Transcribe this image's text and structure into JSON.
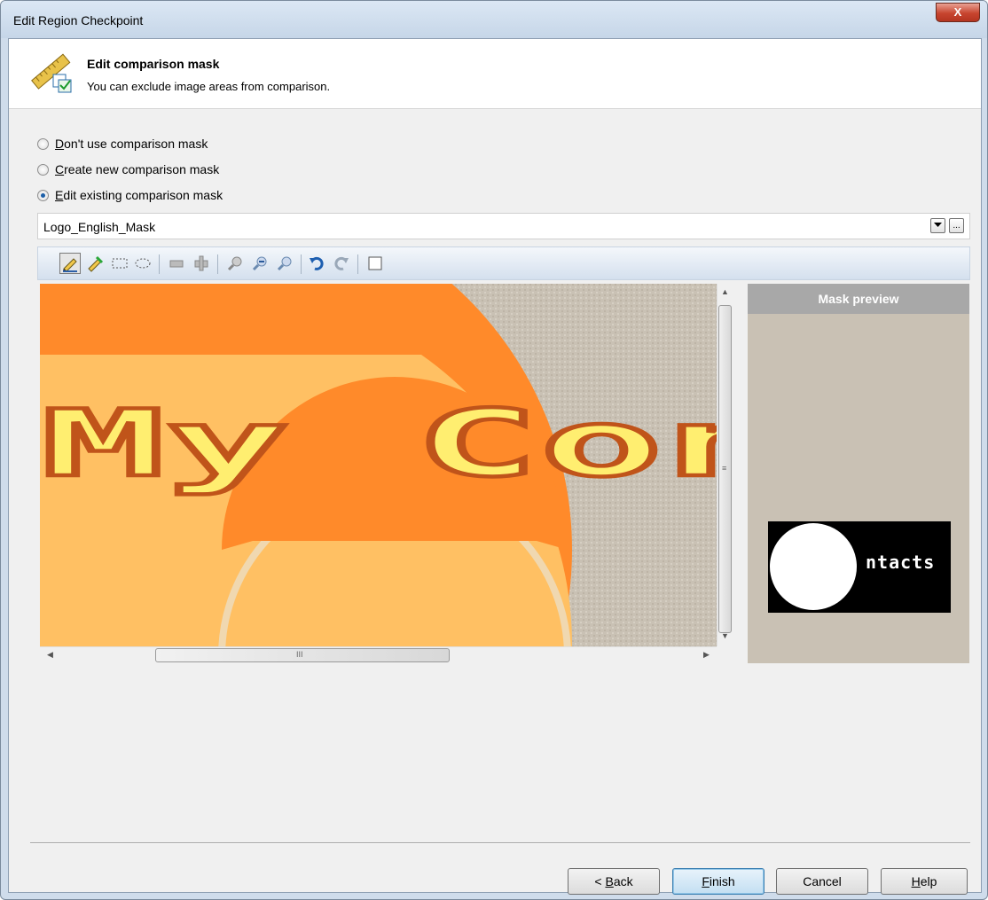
{
  "window": {
    "title": "Edit Region Checkpoint",
    "close_label": "X"
  },
  "header": {
    "title": "Edit comparison mask",
    "subtitle": "You can exclude image areas from comparison."
  },
  "options": [
    {
      "prefix": "",
      "accel": "D",
      "rest": "on't use comparison mask",
      "checked": false
    },
    {
      "prefix": "",
      "accel": "C",
      "rest": "reate new comparison mask",
      "checked": false
    },
    {
      "prefix": "",
      "accel": "E",
      "rest": "dit existing comparison mask",
      "checked": true
    }
  ],
  "mask": {
    "value": "Logo_English_Mask",
    "browse_label": "..."
  },
  "preview": {
    "title": "Mask preview",
    "mask_text": "ntacts"
  },
  "canvas": {
    "text": "My Con"
  },
  "hscroll": {
    "grip": "III"
  },
  "vscroll": {
    "grip": "≡"
  },
  "buttons": {
    "back_prefix": "< ",
    "back_accel": "B",
    "back_rest": "ack",
    "finish_accel": "F",
    "finish_rest": "inish",
    "cancel": "Cancel",
    "help_accel": "H",
    "help_rest": "elp"
  },
  "colors": {
    "orange": "#ff8a2a",
    "light_orange": "#ffc063",
    "texture": "#c9c1b4"
  }
}
